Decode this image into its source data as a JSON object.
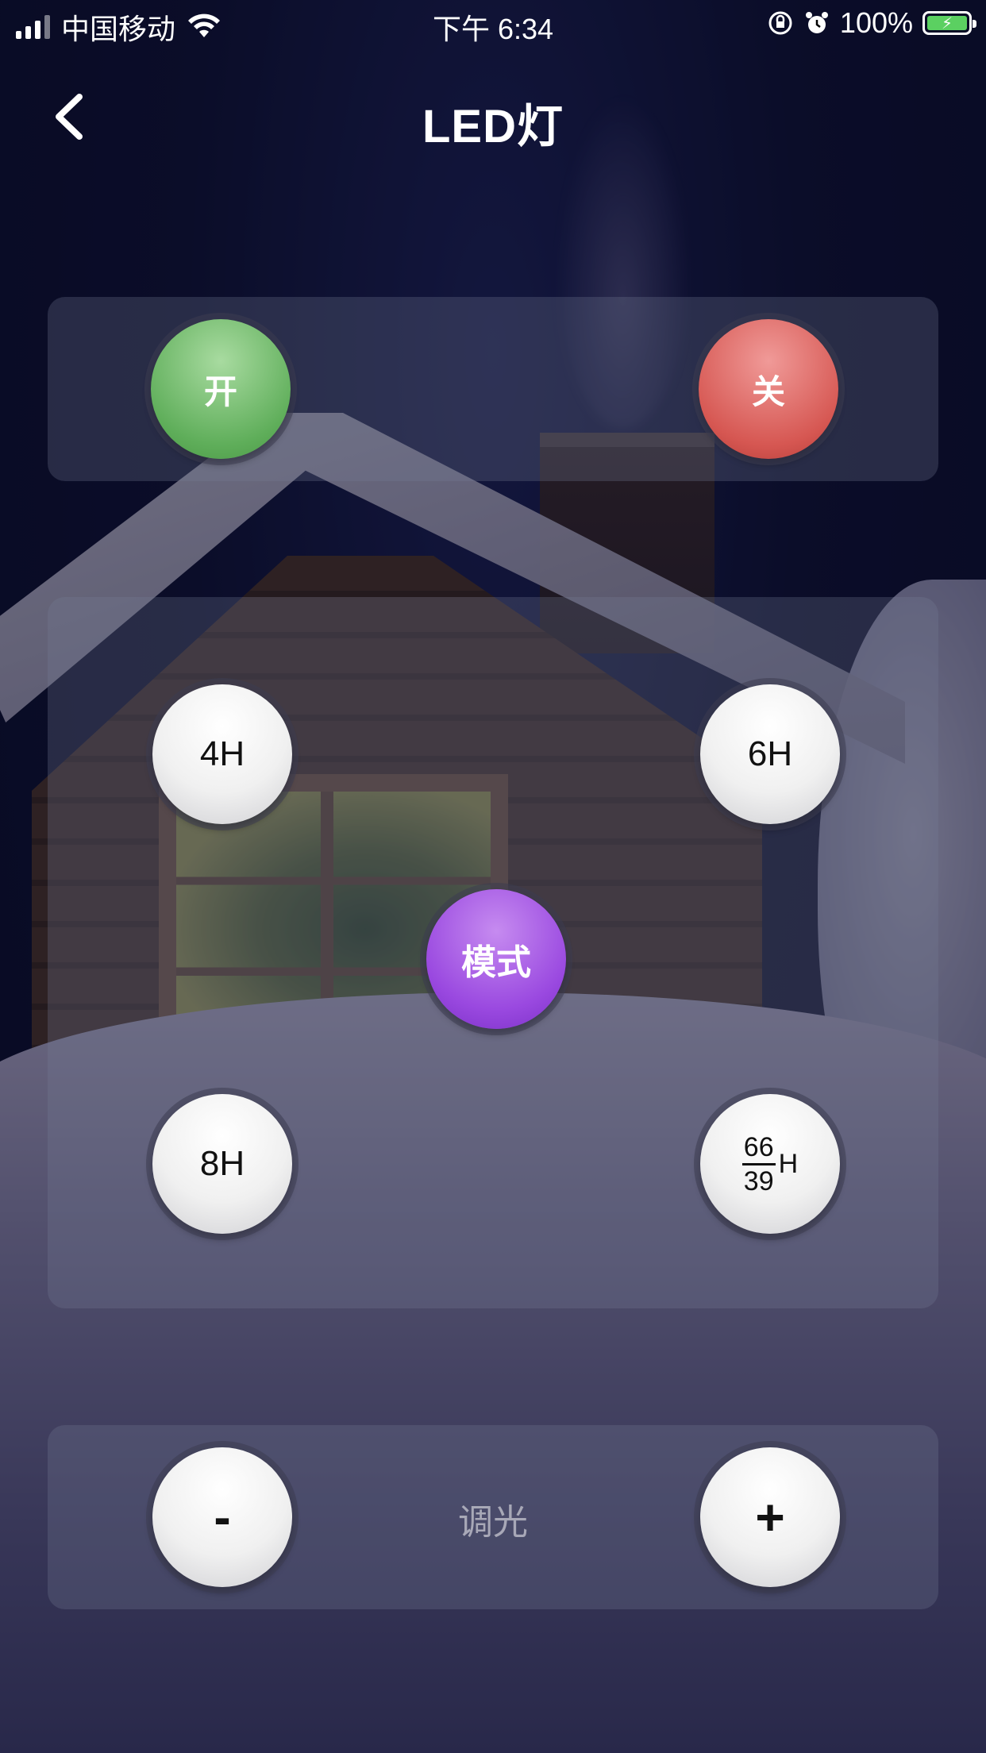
{
  "status_bar": {
    "carrier": "中国移动",
    "time": "下午 6:34",
    "battery_percent": "100%"
  },
  "header": {
    "title": "LED灯",
    "back_icon": "chevron-left-icon"
  },
  "power": {
    "on_label": "开",
    "off_label": "关",
    "on_color": "#5fae5a",
    "off_color": "#d65752"
  },
  "timers": {
    "t4_label": "4H",
    "t6_label": "6H",
    "t8_label": "8H",
    "mode_label": "模式",
    "t_custom_num": "66",
    "t_custom_den": "39",
    "t_custom_unit": "H",
    "mode_color": "#9a49e0"
  },
  "dimmer": {
    "label": "调光",
    "minus_label": "-",
    "plus_label": "+"
  }
}
